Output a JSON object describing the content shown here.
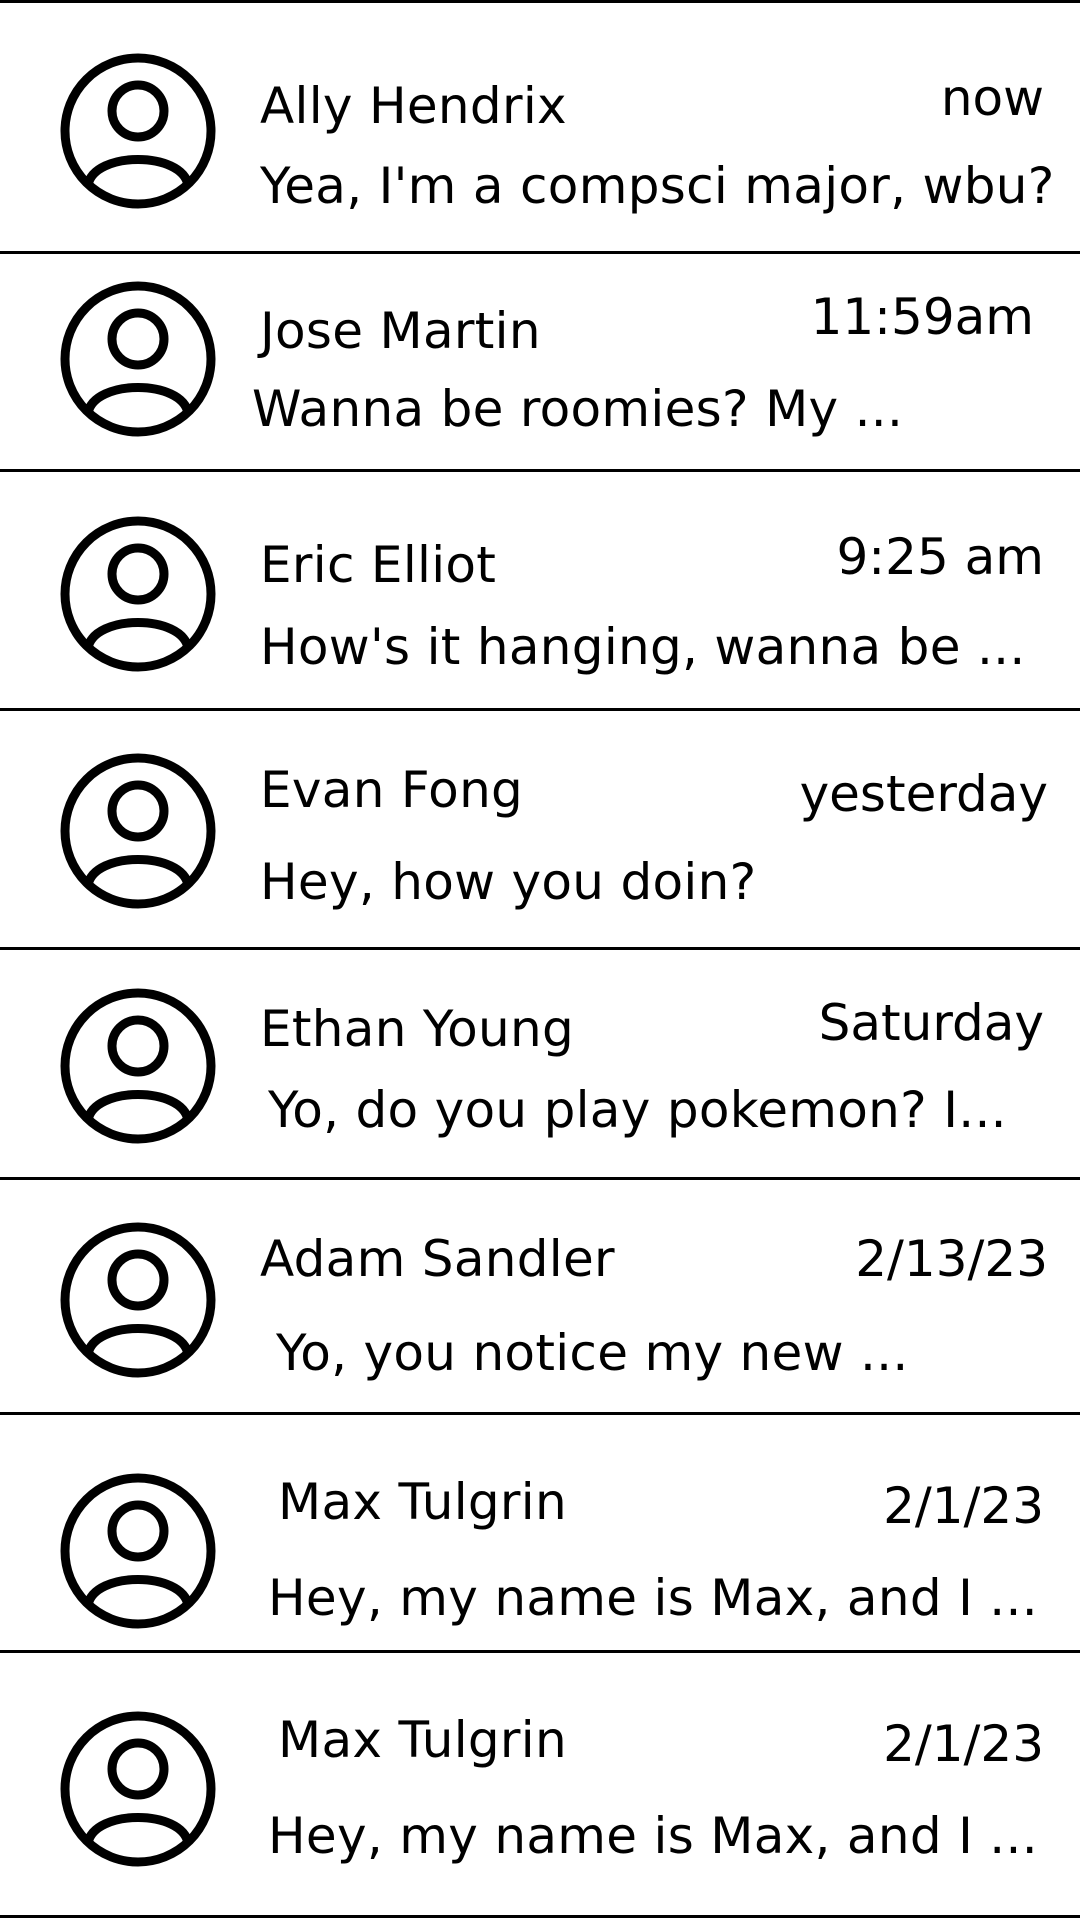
{
  "conversations": [
    {
      "name": "Ally Hendrix",
      "time": "now",
      "preview": "Yea, I'm a compsci major, wbu?",
      "avatar_icon": "user-avatar-icon"
    },
    {
      "name": "Jose Martin",
      "time": "11:59am",
      "preview": "Wanna be roomies? My ...",
      "avatar_icon": "user-avatar-icon"
    },
    {
      "name": "Eric Elliot",
      "time": "9:25 am",
      "preview": "How's it hanging, wanna be ...",
      "avatar_icon": "user-avatar-icon"
    },
    {
      "name": "Evan Fong",
      "time": "yesterday",
      "preview": "Hey, how you doin?",
      "avatar_icon": "user-avatar-icon"
    },
    {
      "name": "Ethan Young",
      "time": "Saturday",
      "preview": "Yo, do you play pokemon? I...",
      "avatar_icon": "user-avatar-icon"
    },
    {
      "name": "Adam Sandler",
      "time": "2/13/23",
      "preview": "Yo, you notice my new ...",
      "avatar_icon": "user-avatar-icon"
    },
    {
      "name": "Max Tulgrin",
      "time": "2/1/23",
      "preview": "Hey, my name is Max, and I ...",
      "avatar_icon": "user-avatar-icon"
    },
    {
      "name": "Max Tulgrin",
      "time": "2/1/23",
      "preview": "Hey, my name is Max, and I ...",
      "avatar_icon": "user-avatar-icon"
    }
  ]
}
